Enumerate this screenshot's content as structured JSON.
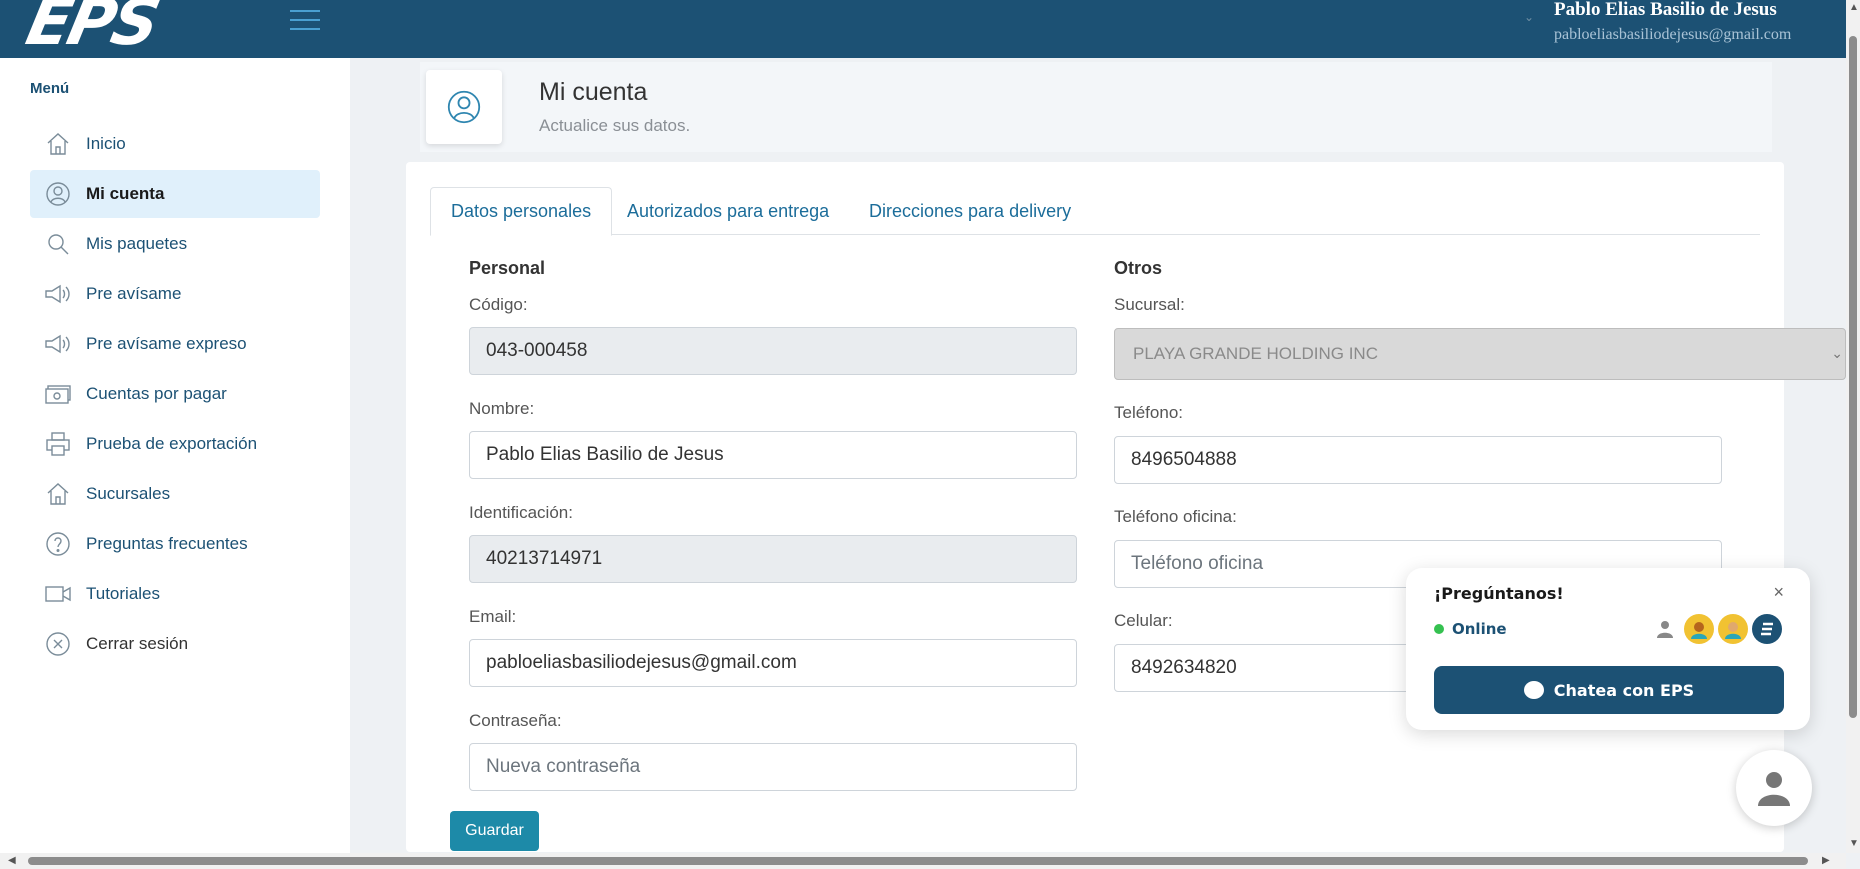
{
  "header": {
    "logo_text": "EPS",
    "user_name": "Pablo Elias Basilio de Jesus",
    "user_email": "pabloeliasbasiliodejesus@gmail.com"
  },
  "sidebar": {
    "title": "Menú",
    "items": [
      {
        "label": "Inicio",
        "icon": "home-icon"
      },
      {
        "label": "Mi cuenta",
        "icon": "user-circle-icon",
        "active": true
      },
      {
        "label": "Mis paquetes",
        "icon": "search-icon"
      },
      {
        "label": "Pre avísame",
        "icon": "megaphone-icon"
      },
      {
        "label": "Pre avísame expreso",
        "icon": "megaphone-icon"
      },
      {
        "label": "Cuentas por pagar",
        "icon": "money-icon"
      },
      {
        "label": "Prueba de exportación",
        "icon": "printer-icon"
      },
      {
        "label": "Sucursales",
        "icon": "home-icon"
      },
      {
        "label": "Preguntas frecuentes",
        "icon": "question-icon"
      },
      {
        "label": "Tutoriales",
        "icon": "video-icon"
      },
      {
        "label": "Cerrar sesión",
        "icon": "close-circle-icon"
      }
    ]
  },
  "page": {
    "title": "Mi cuenta",
    "subtitle": "Actualice sus datos."
  },
  "tabs": [
    {
      "label": "Datos personales",
      "active": true
    },
    {
      "label": "Autorizados para entrega"
    },
    {
      "label": "Direcciones para delivery"
    }
  ],
  "personal": {
    "section_title": "Personal",
    "codigo_label": "Código:",
    "codigo_value": "043-000458",
    "nombre_label": "Nombre:",
    "nombre_value": "Pablo Elias Basilio de Jesus",
    "identificacion_label": "Identificación:",
    "identificacion_value": "40213714971",
    "email_label": "Email:",
    "email_value": "pabloeliasbasiliodejesus@gmail.com",
    "password_label": "Contraseña:",
    "password_placeholder": "Nueva contraseña"
  },
  "otros": {
    "section_title": "Otros",
    "sucursal_label": "Sucursal:",
    "sucursal_value": "PLAYA GRANDE HOLDING INC",
    "telefono_label": "Teléfono:",
    "telefono_value": "8496504888",
    "telefono_oficina_label": "Teléfono oficina:",
    "telefono_oficina_placeholder": "Teléfono oficina",
    "celular_label": "Celular:",
    "celular_value": "8492634820"
  },
  "actions": {
    "save_label": "Guardar"
  },
  "chat": {
    "title": "¡Pregúntanos!",
    "status": "Online",
    "button_label": "Chatea con EPS",
    "close_symbol": "×"
  },
  "colors": {
    "brand": "#1c5174",
    "accent": "#1d8aa8",
    "online": "#35c150"
  }
}
